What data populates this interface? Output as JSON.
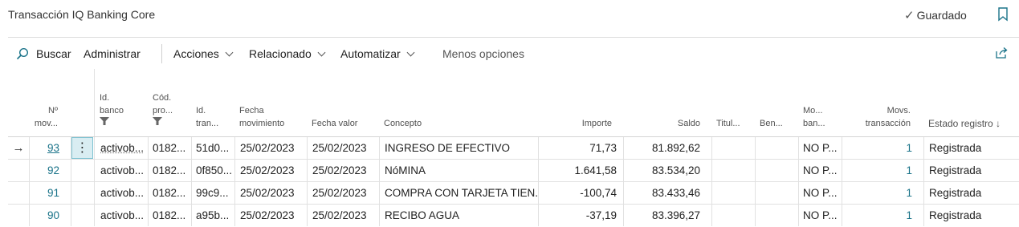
{
  "header": {
    "title": "Transacción IQ Banking Core",
    "saved_label": "Guardado"
  },
  "actions": {
    "search": "Buscar",
    "manage": "Administrar",
    "actions": "Acciones",
    "related": "Relacionado",
    "automate": "Automatizar",
    "fewer": "Menos opciones"
  },
  "columns": {
    "num1": "Nº",
    "num2": "mov...",
    "bank1": "Id.",
    "bank2": "banco",
    "prod1": "Cód.",
    "prod2": "pro...",
    "tran1": "Id.",
    "tran2": "tran...",
    "date1": "Fecha",
    "date2": "movimiento",
    "valuedate": "Fecha valor",
    "concept": "Concepto",
    "amount": "Importe",
    "balance": "Saldo",
    "holder": "Titul...",
    "benef": "Ben...",
    "bankmov1": "Mo...",
    "bankmov2": "ban...",
    "transmov1": "Movs.",
    "transmov2": "transacción",
    "status": "Estado registro ↓"
  },
  "rows": [
    {
      "num": "93",
      "bank": "activob...",
      "prod": "0182...",
      "tran": "51d0...",
      "date": "25/02/2023",
      "valuedate": "25/02/2023",
      "concept": "INGRESO DE EFECTIVO",
      "amount": "71,73",
      "balance": "81.892,62",
      "bankmov": "NO P...",
      "movs": "1",
      "status": "Registrada"
    },
    {
      "num": "92",
      "bank": "activob...",
      "prod": "0182...",
      "tran": "0f850...",
      "date": "25/02/2023",
      "valuedate": "25/02/2023",
      "concept": "NóMINA",
      "amount": "1.641,58",
      "balance": "83.534,20",
      "bankmov": "NO P...",
      "movs": "1",
      "status": "Registrada"
    },
    {
      "num": "91",
      "bank": "activob...",
      "prod": "0182...",
      "tran": "99c9...",
      "date": "25/02/2023",
      "valuedate": "25/02/2023",
      "concept": "COMPRA CON TARJETA TIEN...",
      "amount": "-100,74",
      "balance": "83.433,46",
      "bankmov": "NO P...",
      "movs": "1",
      "status": "Registrada"
    },
    {
      "num": "90",
      "bank": "activob...",
      "prod": "0182...",
      "tran": "a95b...",
      "date": "25/02/2023",
      "valuedate": "25/02/2023",
      "concept": "RECIBO AGUA",
      "amount": "-37,19",
      "balance": "83.396,27",
      "bankmov": "NO P...",
      "movs": "1",
      "status": "Registrada"
    }
  ],
  "colors": {
    "accent": "#1a7389",
    "selected_cell": "#d9edf2"
  }
}
